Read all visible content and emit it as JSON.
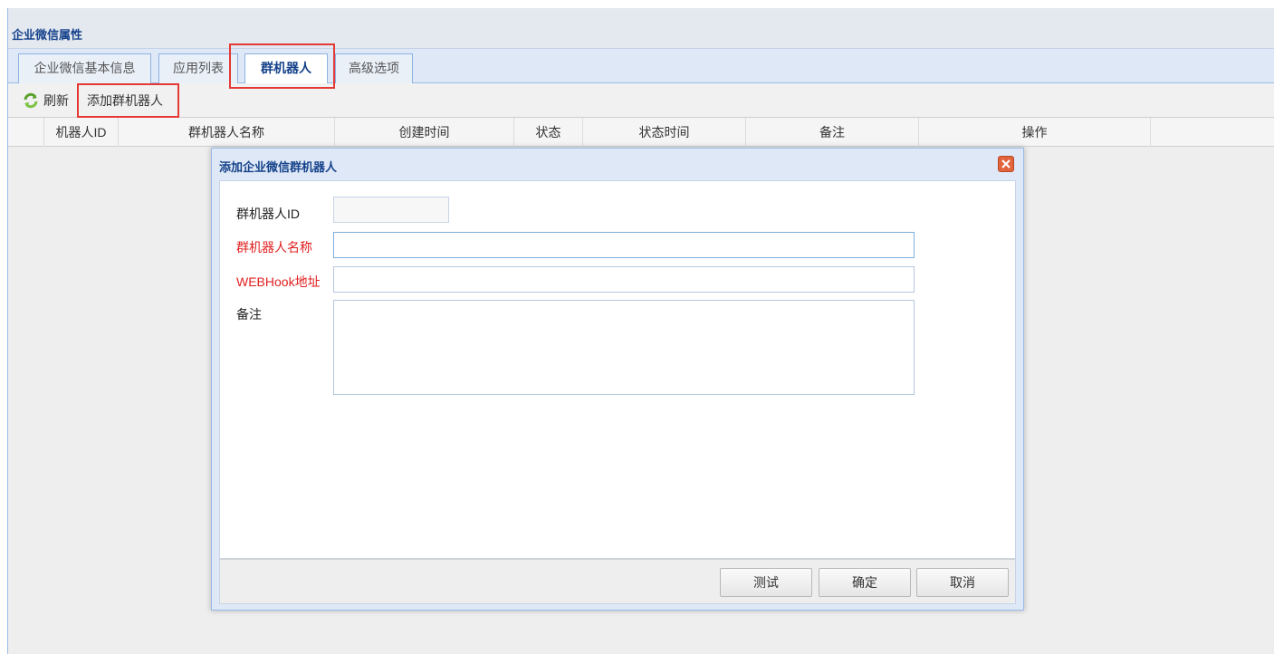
{
  "panel": {
    "title": "企业微信属性"
  },
  "tabs": [
    {
      "label": "企业微信基本信息"
    },
    {
      "label": "应用列表"
    },
    {
      "label": "群机器人"
    },
    {
      "label": "高级选项"
    }
  ],
  "toolbar": {
    "refresh_label": "刷新",
    "add_label": "添加群机器人"
  },
  "grid": {
    "columns": [
      "机器人ID",
      "群机器人名称",
      "创建时间",
      "状态",
      "状态时间",
      "备注",
      "操作"
    ]
  },
  "dialog": {
    "title": "添加企业微信群机器人",
    "fields": {
      "robot_id": {
        "label": "群机器人ID",
        "value": ""
      },
      "robot_name": {
        "label": "群机器人名称",
        "value": ""
      },
      "webhook": {
        "label": "WEBHook地址",
        "value": ""
      },
      "remark": {
        "label": "备注",
        "value": ""
      }
    },
    "buttons": {
      "test": "测试",
      "ok": "确定",
      "cancel": "取消"
    }
  },
  "colors": {
    "required_label": "#e02020",
    "highlight_box": "#e53935",
    "title_text": "#15428b"
  },
  "icons": {
    "refresh": "refresh-icon",
    "close": "close-icon"
  }
}
